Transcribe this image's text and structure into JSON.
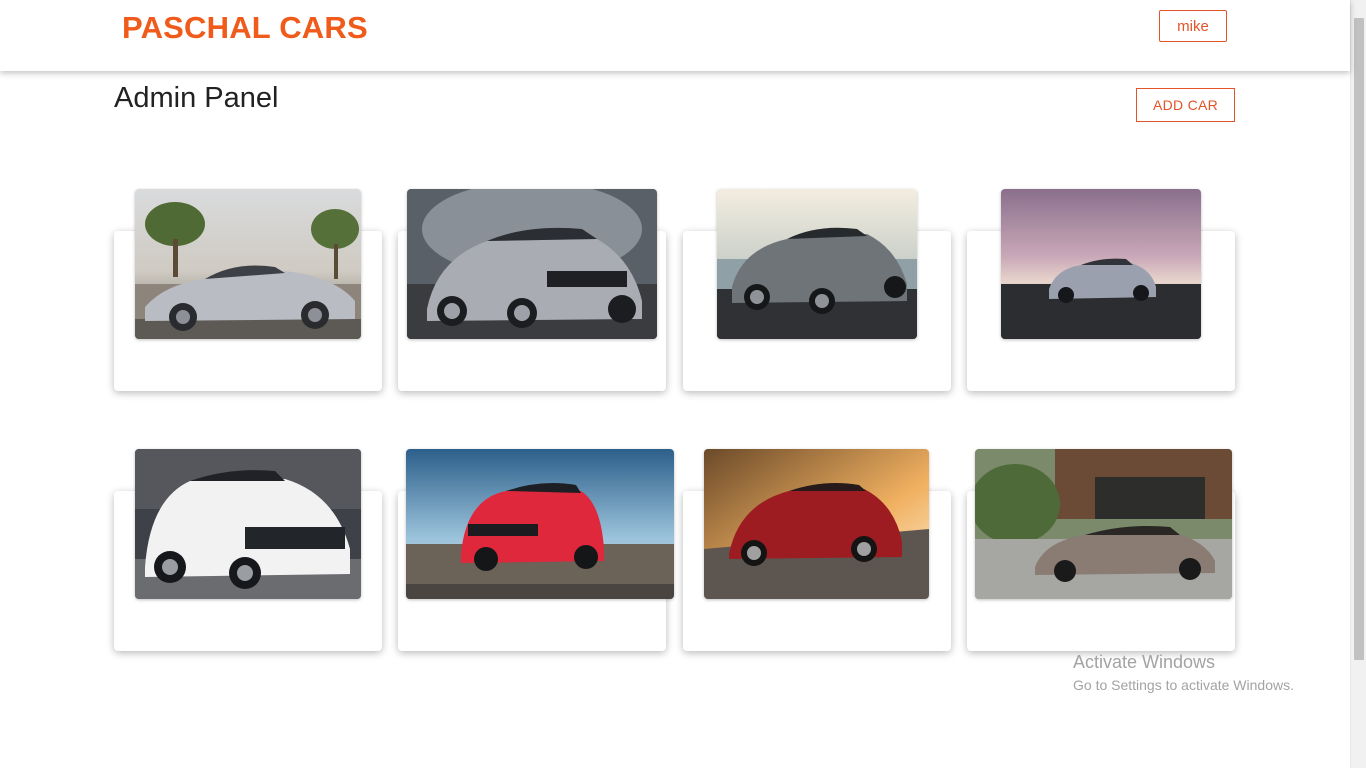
{
  "header": {
    "brand": "PASCHAL CARS",
    "user_label": "mike"
  },
  "main": {
    "title": "Admin Panel",
    "add_button_label": "ADD CAR"
  },
  "cars": [
    {
      "scene": "desert-road",
      "body_color": "#b9bcc2"
    },
    {
      "scene": "night-plaza",
      "body_color": "#a9acb2"
    },
    {
      "scene": "sunset-lake",
      "body_color": "#6e7478"
    },
    {
      "scene": "pink-sky-shore",
      "body_color": "#9aa0ad"
    },
    {
      "scene": "garage-white",
      "body_color": "#f2f2f2"
    },
    {
      "scene": "blue-sky-track",
      "body_color": "#e0283c"
    },
    {
      "scene": "sunset-road",
      "body_color": "#9c1c22"
    },
    {
      "scene": "modern-house",
      "body_color": "#8a7c72"
    }
  ],
  "watermark": {
    "title": "Activate Windows",
    "subtitle": "Go to Settings to activate Windows."
  }
}
